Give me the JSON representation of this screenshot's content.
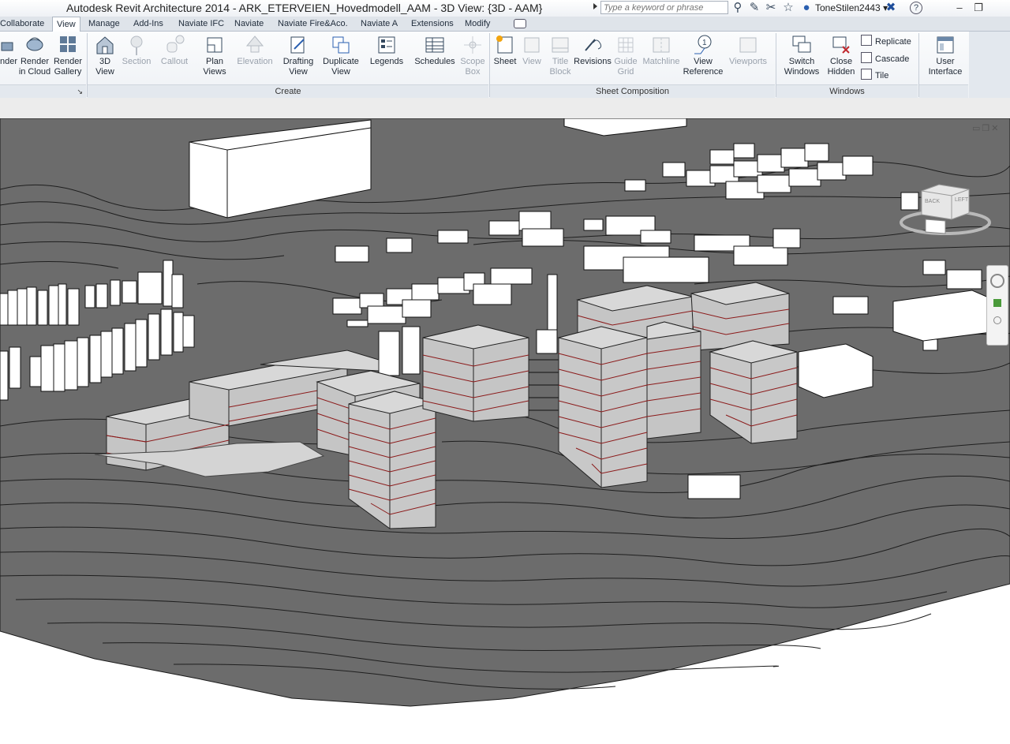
{
  "titlebar": {
    "app_title": "Autodesk Revit Architecture 2014 -    ARK_ETERVEIEN_Hovedmodell_AAM - 3D View: {3D - AAM}",
    "search_placeholder": "Type a keyword or phrase",
    "user_name": "ToneStilen2443",
    "user_dropdown": "▾"
  },
  "tabs": [
    "Collaborate",
    "View",
    "Manage",
    "Add-Ins",
    "Naviate IFC",
    "Naviate",
    "Naviate Fire&Aco.",
    "Naviate A",
    "Extensions",
    "Modify"
  ],
  "active_tab": "View",
  "ribbon": {
    "graphics_panel": {
      "buttons": [
        {
          "label": "nder",
          "label2": ""
        },
        {
          "label": "Render",
          "label2": "in Cloud"
        },
        {
          "label": "Render",
          "label2": "Gallery"
        }
      ],
      "launcher": "↘"
    },
    "create_panel": {
      "title": "Create",
      "buttons": [
        {
          "label": "3D",
          "label2": "View",
          "enabled": true
        },
        {
          "label": "Section",
          "label2": "",
          "enabled": false
        },
        {
          "label": "Callout",
          "label2": "",
          "enabled": false
        },
        {
          "label": "Plan",
          "label2": "Views",
          "enabled": true
        },
        {
          "label": "Elevation",
          "label2": "",
          "enabled": false
        },
        {
          "label": "Drafting",
          "label2": "View",
          "enabled": true
        },
        {
          "label": "Duplicate",
          "label2": "View",
          "enabled": true
        },
        {
          "label": "Legends",
          "label2": "",
          "enabled": true
        },
        {
          "label": "Schedules",
          "label2": "",
          "enabled": true
        },
        {
          "label": "Scope",
          "label2": "Box",
          "enabled": false
        }
      ]
    },
    "sheet_panel": {
      "title": "Sheet Composition",
      "buttons": [
        {
          "label": "Sheet",
          "label2": "",
          "enabled": true
        },
        {
          "label": "View",
          "label2": "",
          "enabled": false
        },
        {
          "label": "Title",
          "label2": "Block",
          "enabled": false
        },
        {
          "label": "Revisions",
          "label2": "",
          "enabled": true
        },
        {
          "label": "Guide",
          "label2": "Grid",
          "enabled": false
        },
        {
          "label": "Matchline",
          "label2": "",
          "enabled": false
        },
        {
          "label": "View",
          "label2": "Reference",
          "enabled": true
        },
        {
          "label": "Viewports",
          "label2": "",
          "enabled": false
        }
      ]
    },
    "windows_panel": {
      "title": "Windows",
      "buttons": [
        {
          "label": "Switch",
          "label2": "Windows"
        },
        {
          "label": "Close",
          "label2": "Hidden"
        }
      ],
      "small_buttons": [
        "Replicate",
        "Cascade",
        "Tile"
      ]
    },
    "ui_panel": {
      "buttons": [
        {
          "label": "User",
          "label2": "Interface"
        }
      ]
    }
  },
  "viewcube": {
    "face_labels": [
      "BACK",
      "LEFT"
    ]
  },
  "colors": {
    "terrain": "#6e6e6e",
    "contour": "#1a1a1a",
    "building_face": "#c4c4c4",
    "building_top": "#d6d6d6",
    "floor_line": "#8b1a1a",
    "context_block": "#ffffff"
  }
}
